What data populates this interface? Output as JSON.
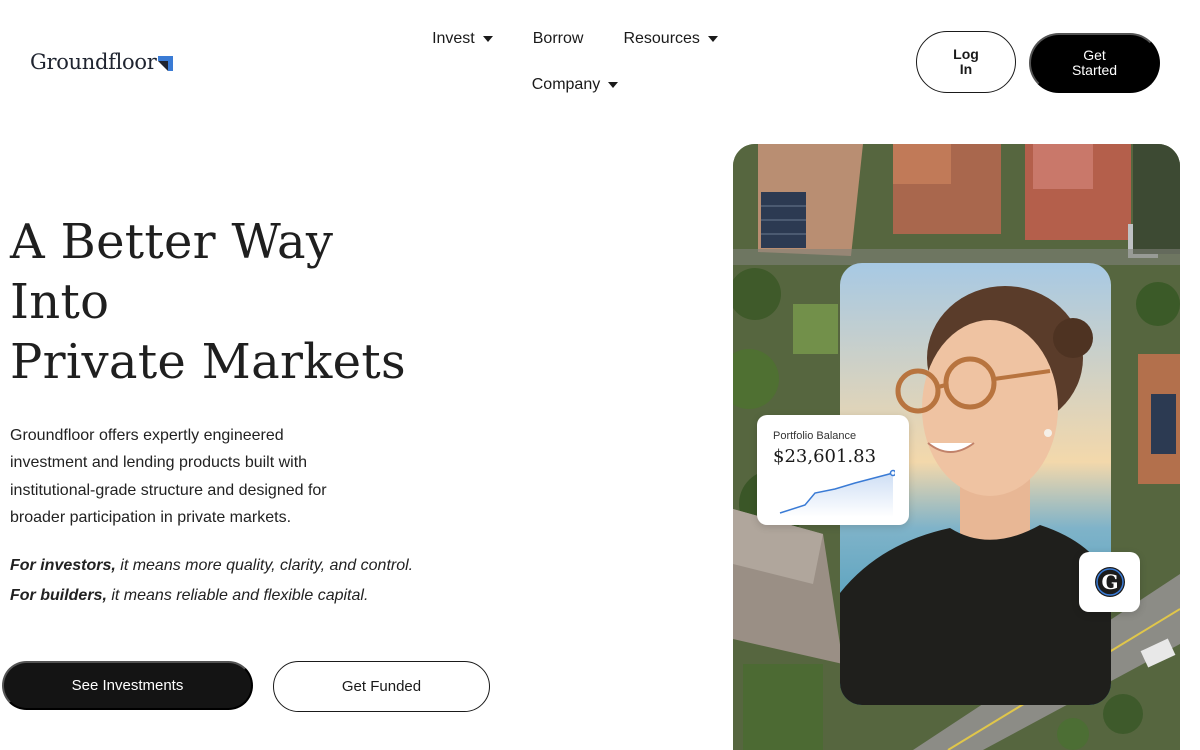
{
  "header": {
    "logo_text": "Groundfloor",
    "nav": [
      {
        "label": "Invest",
        "dropdown": true
      },
      {
        "label": "Borrow",
        "dropdown": false
      },
      {
        "label": "Resources",
        "dropdown": true
      },
      {
        "label": "Company",
        "dropdown": true
      }
    ],
    "login_label": "Log In",
    "get_started_label": "Get Started"
  },
  "hero": {
    "title_lines": [
      "A Better Way",
      "Into",
      "Private Markets"
    ],
    "body": "Groundfloor offers expertly engineered investment and lending products built with institutional-grade structure and designed for broader participation in private markets.",
    "tagline_investors_bold": "For investors,",
    "tagline_investors_rest": " it means more quality, clarity, and control.",
    "tagline_builders_bold": "For builders,",
    "tagline_builders_rest": " it means reliable and flexible capital.",
    "cta_primary": "See Investments",
    "cta_secondary": "Get Funded"
  },
  "portfolio_card": {
    "label": "Portfolio Balance",
    "value": "$23,601.83"
  },
  "badge": {
    "letter": "G"
  },
  "colors": {
    "primary_button": "#141414",
    "accent_blue": "#3a7bd5",
    "text": "#1a1a1a"
  },
  "icons": {
    "logo_mark": "logo-mark-icon",
    "dropdown": "caret-down-icon",
    "badge": "groundfloor-g-icon"
  }
}
